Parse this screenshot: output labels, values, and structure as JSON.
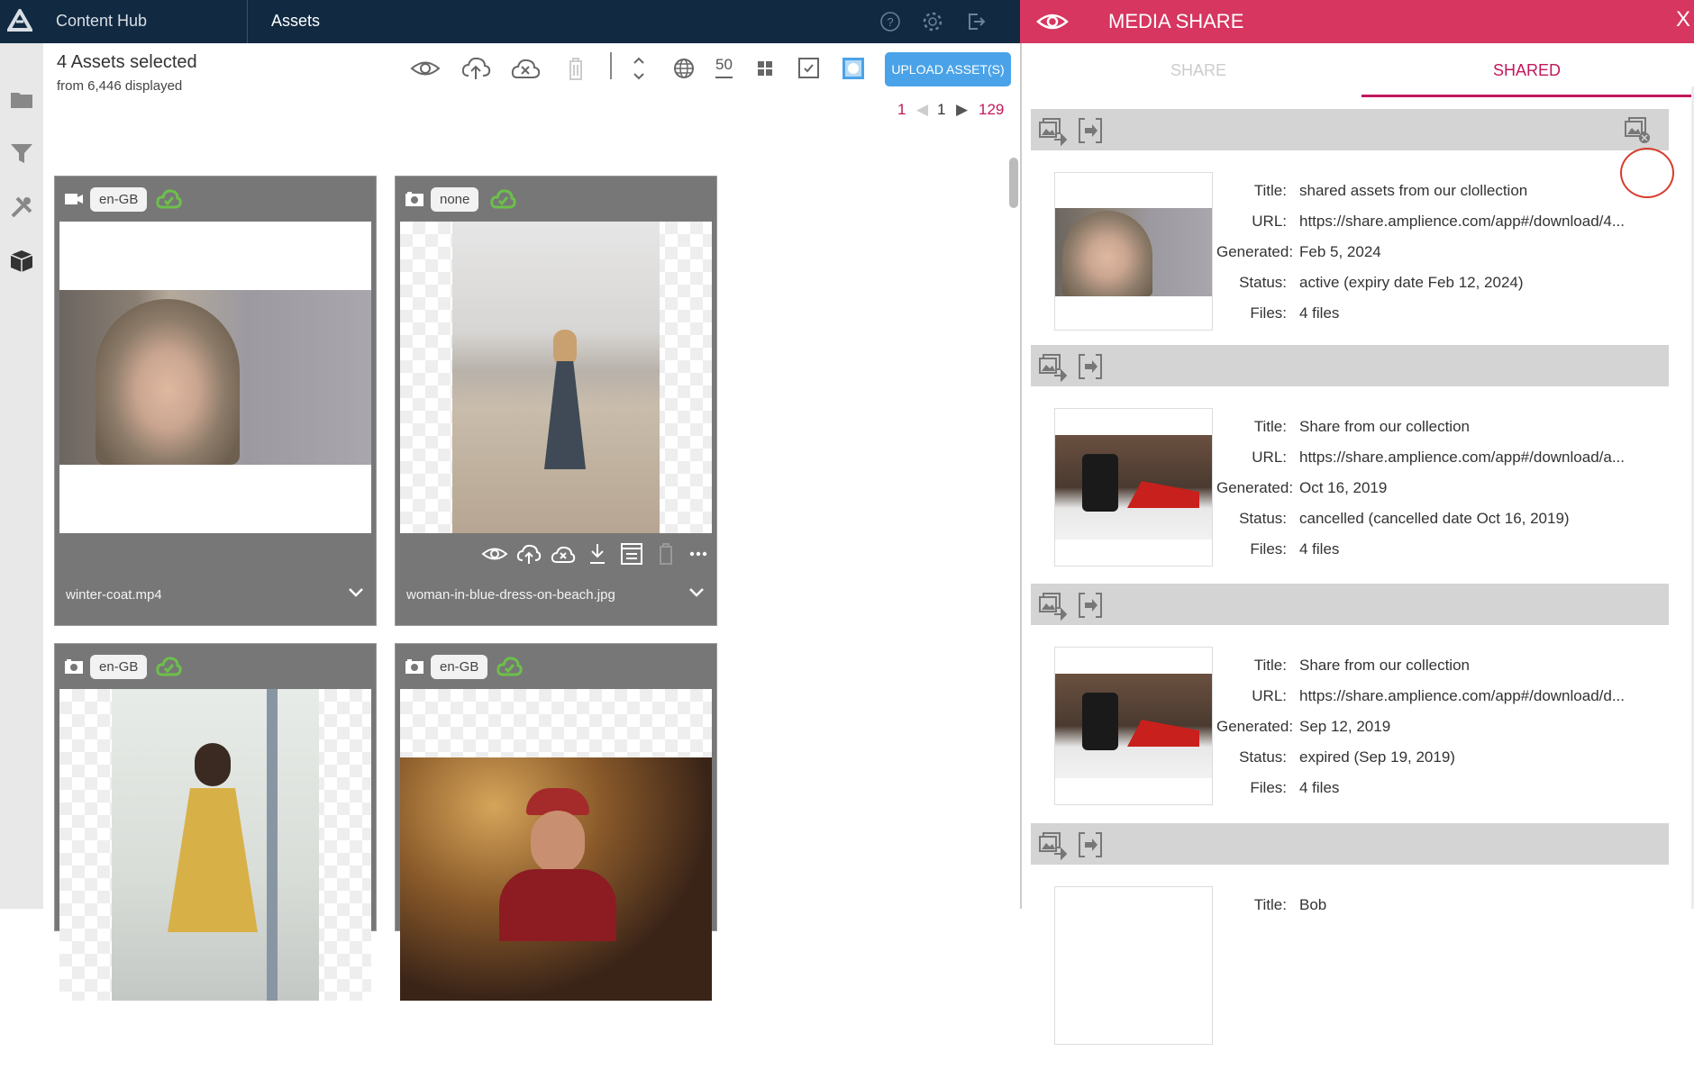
{
  "topbar": {
    "app_title": "Content Hub",
    "section_title": "Assets",
    "icons": [
      "help-icon",
      "settings-icon",
      "logout-icon"
    ]
  },
  "sidebar": {
    "items": [
      {
        "name": "folder-icon"
      },
      {
        "name": "filter-icon"
      },
      {
        "name": "tools-icon"
      },
      {
        "name": "package-icon"
      }
    ]
  },
  "header": {
    "selected": "4 Assets selected",
    "from": "from 6,446 displayed"
  },
  "toolbar": {
    "page_size": "50",
    "upload_label": "UPLOAD ASSET(S)",
    "icons": [
      "eye-icon",
      "cloud-upload-icon",
      "cloud-cancel-icon",
      "trash-icon",
      "sort-icon",
      "globe-icon",
      "page-size",
      "grid-icon",
      "checkbox-icon",
      "select-all-icon"
    ]
  },
  "pager": {
    "first": "1",
    "current": "1",
    "last": "129"
  },
  "assets": [
    {
      "type": "video",
      "locale": "en-GB",
      "filename": "winter-coat.mp4"
    },
    {
      "type": "image",
      "locale": "none",
      "filename": "woman-in-blue-dress-on-beach.jpg"
    },
    {
      "type": "image",
      "locale": "en-GB",
      "filename": ""
    },
    {
      "type": "image",
      "locale": "en-GB",
      "filename": ""
    }
  ],
  "media_share": {
    "title": "MEDIA SHARE",
    "close": "X",
    "tabs": [
      {
        "label": "SHARE",
        "active": false
      },
      {
        "label": "SHARED",
        "active": true
      }
    ],
    "labels": {
      "title": "Title:",
      "url": "URL:",
      "generated": "Generated:",
      "status": "Status:",
      "files": "Files:"
    },
    "shares": [
      {
        "title": "shared assets from our clollection",
        "url": "https://share.amplience.com/app#/download/4...",
        "generated": "Feb 5, 2024",
        "status": "active (expiry date Feb 12, 2024)",
        "files": "4 files"
      },
      {
        "title": "Share from our collection",
        "url": "https://share.amplience.com/app#/download/a...",
        "generated": "Oct 16, 2019",
        "status": "cancelled (cancelled date Oct 16, 2019)",
        "files": "4 files"
      },
      {
        "title": "Share from our collection",
        "url": "https://share.amplience.com/app#/download/d...",
        "generated": "Sep 12, 2019",
        "status": "expired (Sep 19, 2019)",
        "files": "4 files"
      },
      {
        "title": "Bob"
      }
    ]
  },
  "colors": {
    "topbar": "#112a42",
    "accent": "#d6365f",
    "upload": "#4aa3e8",
    "cloud_ok": "#6cc04a"
  }
}
